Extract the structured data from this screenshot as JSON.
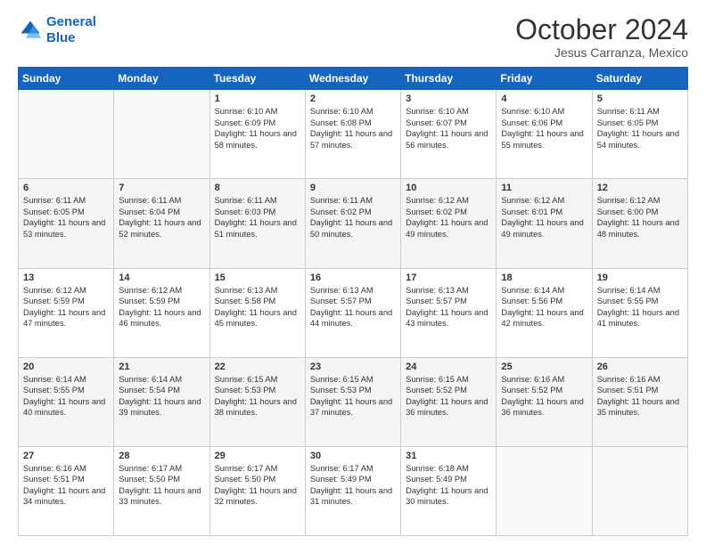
{
  "header": {
    "logo_line1": "General",
    "logo_line2": "Blue",
    "title": "October 2024",
    "subtitle": "Jesus Carranza, Mexico"
  },
  "days_of_week": [
    "Sunday",
    "Monday",
    "Tuesday",
    "Wednesday",
    "Thursday",
    "Friday",
    "Saturday"
  ],
  "weeks": [
    [
      {
        "day": "",
        "content": ""
      },
      {
        "day": "",
        "content": ""
      },
      {
        "day": "1",
        "content": "Sunrise: 6:10 AM\nSunset: 6:09 PM\nDaylight: 11 hours and 58 minutes."
      },
      {
        "day": "2",
        "content": "Sunrise: 6:10 AM\nSunset: 6:08 PM\nDaylight: 11 hours and 57 minutes."
      },
      {
        "day": "3",
        "content": "Sunrise: 6:10 AM\nSunset: 6:07 PM\nDaylight: 11 hours and 56 minutes."
      },
      {
        "day": "4",
        "content": "Sunrise: 6:10 AM\nSunset: 6:06 PM\nDaylight: 11 hours and 55 minutes."
      },
      {
        "day": "5",
        "content": "Sunrise: 6:11 AM\nSunset: 6:05 PM\nDaylight: 11 hours and 54 minutes."
      }
    ],
    [
      {
        "day": "6",
        "content": "Sunrise: 6:11 AM\nSunset: 6:05 PM\nDaylight: 11 hours and 53 minutes."
      },
      {
        "day": "7",
        "content": "Sunrise: 6:11 AM\nSunset: 6:04 PM\nDaylight: 11 hours and 52 minutes."
      },
      {
        "day": "8",
        "content": "Sunrise: 6:11 AM\nSunset: 6:03 PM\nDaylight: 11 hours and 51 minutes."
      },
      {
        "day": "9",
        "content": "Sunrise: 6:11 AM\nSunset: 6:02 PM\nDaylight: 11 hours and 50 minutes."
      },
      {
        "day": "10",
        "content": "Sunrise: 6:12 AM\nSunset: 6:02 PM\nDaylight: 11 hours and 49 minutes."
      },
      {
        "day": "11",
        "content": "Sunrise: 6:12 AM\nSunset: 6:01 PM\nDaylight: 11 hours and 49 minutes."
      },
      {
        "day": "12",
        "content": "Sunrise: 6:12 AM\nSunset: 6:00 PM\nDaylight: 11 hours and 48 minutes."
      }
    ],
    [
      {
        "day": "13",
        "content": "Sunrise: 6:12 AM\nSunset: 5:59 PM\nDaylight: 11 hours and 47 minutes."
      },
      {
        "day": "14",
        "content": "Sunrise: 6:12 AM\nSunset: 5:59 PM\nDaylight: 11 hours and 46 minutes."
      },
      {
        "day": "15",
        "content": "Sunrise: 6:13 AM\nSunset: 5:58 PM\nDaylight: 11 hours and 45 minutes."
      },
      {
        "day": "16",
        "content": "Sunrise: 6:13 AM\nSunset: 5:57 PM\nDaylight: 11 hours and 44 minutes."
      },
      {
        "day": "17",
        "content": "Sunrise: 6:13 AM\nSunset: 5:57 PM\nDaylight: 11 hours and 43 minutes."
      },
      {
        "day": "18",
        "content": "Sunrise: 6:14 AM\nSunset: 5:56 PM\nDaylight: 11 hours and 42 minutes."
      },
      {
        "day": "19",
        "content": "Sunrise: 6:14 AM\nSunset: 5:55 PM\nDaylight: 11 hours and 41 minutes."
      }
    ],
    [
      {
        "day": "20",
        "content": "Sunrise: 6:14 AM\nSunset: 5:55 PM\nDaylight: 11 hours and 40 minutes."
      },
      {
        "day": "21",
        "content": "Sunrise: 6:14 AM\nSunset: 5:54 PM\nDaylight: 11 hours and 39 minutes."
      },
      {
        "day": "22",
        "content": "Sunrise: 6:15 AM\nSunset: 5:53 PM\nDaylight: 11 hours and 38 minutes."
      },
      {
        "day": "23",
        "content": "Sunrise: 6:15 AM\nSunset: 5:53 PM\nDaylight: 11 hours and 37 minutes."
      },
      {
        "day": "24",
        "content": "Sunrise: 6:15 AM\nSunset: 5:52 PM\nDaylight: 11 hours and 36 minutes."
      },
      {
        "day": "25",
        "content": "Sunrise: 6:16 AM\nSunset: 5:52 PM\nDaylight: 11 hours and 36 minutes."
      },
      {
        "day": "26",
        "content": "Sunrise: 6:16 AM\nSunset: 5:51 PM\nDaylight: 11 hours and 35 minutes."
      }
    ],
    [
      {
        "day": "27",
        "content": "Sunrise: 6:16 AM\nSunset: 5:51 PM\nDaylight: 11 hours and 34 minutes."
      },
      {
        "day": "28",
        "content": "Sunrise: 6:17 AM\nSunset: 5:50 PM\nDaylight: 11 hours and 33 minutes."
      },
      {
        "day": "29",
        "content": "Sunrise: 6:17 AM\nSunset: 5:50 PM\nDaylight: 11 hours and 32 minutes."
      },
      {
        "day": "30",
        "content": "Sunrise: 6:17 AM\nSunset: 5:49 PM\nDaylight: 11 hours and 31 minutes."
      },
      {
        "day": "31",
        "content": "Sunrise: 6:18 AM\nSunset: 5:49 PM\nDaylight: 11 hours and 30 minutes."
      },
      {
        "day": "",
        "content": ""
      },
      {
        "day": "",
        "content": ""
      }
    ]
  ]
}
